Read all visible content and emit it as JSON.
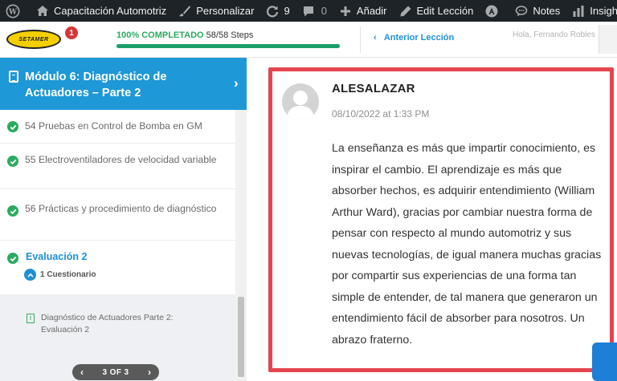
{
  "adminbar": {
    "site_name": "Capacitación Automotriz",
    "customize": "Personalizar",
    "updates_count": "9",
    "comments_count": "0",
    "new": "Añadir",
    "edit": "Edit Lección",
    "notes": "Notes",
    "insights": "Insights"
  },
  "header": {
    "logo_text": "SETAMER",
    "notification_count": "1",
    "progress_percent_label": "100% COMPLETADO",
    "progress_steps": "58/58 Steps",
    "progress_value": 1.0,
    "previous_lesson": "Anterior Lección",
    "greeting": "Hola, Fernando Robles"
  },
  "sidebar": {
    "module_title": "Módulo 6: Diagnóstico de Actuadores – Parte 2",
    "lessons": [
      {
        "label": "54 Pruebas en Control de Bomba en GM"
      },
      {
        "label": "55 Electroventiladores de velocidad variable"
      },
      {
        "label": "56 Prácticas y procedimiento de diagnóstico"
      }
    ],
    "evaluation_label": "Evaluación 2",
    "quiz_count": "1 Cuestionario",
    "quiz_item": "Diagnóstico de Actuadores Parte 2: Evaluación 2",
    "pager": "3 OF 3"
  },
  "comment": {
    "author": "ALESALAZAR",
    "date": "08/10/2022 at 1:33 PM",
    "body": "La enseñanza es más que impartir conocimiento, es inspirar el cambio. El aprendizaje es más que absorber hechos, es adquirir entendimiento (William Arthur Ward), gracias por cambiar nuestra forma de pensar con respecto al mundo automotriz y sus nuevas tecnologías, de igual manera muchas gracias por compartir sus experiencias de una forma tan simple de entender, de tal manera que generaron un entendimiento fácil de absorber para nosotros. Un abrazo fraterno."
  },
  "colors": {
    "accent": "#1e98d6",
    "success": "#2bab5f",
    "highlight_border": "#e54550",
    "adminbar": "#1d2327"
  }
}
